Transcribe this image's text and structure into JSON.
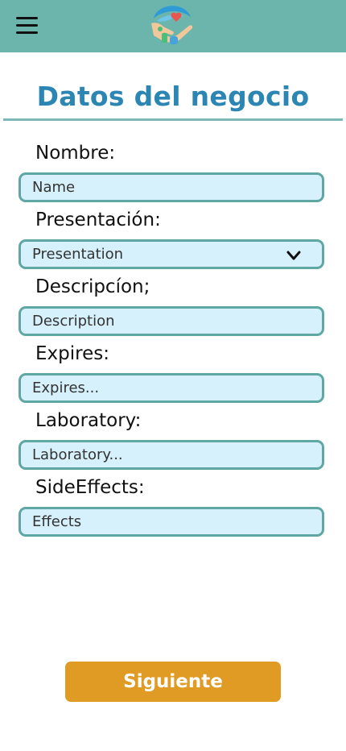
{
  "header": {
    "menu_icon": "hamburger-menu-icon",
    "logo_icon": "hands-heart-medicine-logo",
    "bar_color": "#6bb5ad"
  },
  "page": {
    "title": "Datos del negocio",
    "title_color": "#2b86b3"
  },
  "form": {
    "name": {
      "label": "Nombre:",
      "placeholder": "Name"
    },
    "presentation": {
      "label": "Presentación:",
      "value": "Presentation",
      "icon": "chevron-down-icon"
    },
    "description": {
      "label": "Descripcíon;",
      "placeholder": "Description"
    },
    "expires": {
      "label": "Expires:",
      "placeholder": "Expires..."
    },
    "laboratory": {
      "label": "Laboratory:",
      "placeholder": "Laboratory..."
    },
    "side_effects": {
      "label": "SideEffects:",
      "placeholder": "Effects"
    },
    "field_bg": "#d6f1fb",
    "field_border": "#5fa7a2"
  },
  "footer": {
    "next_label": "Siguiente",
    "next_color": "#e09b24"
  }
}
